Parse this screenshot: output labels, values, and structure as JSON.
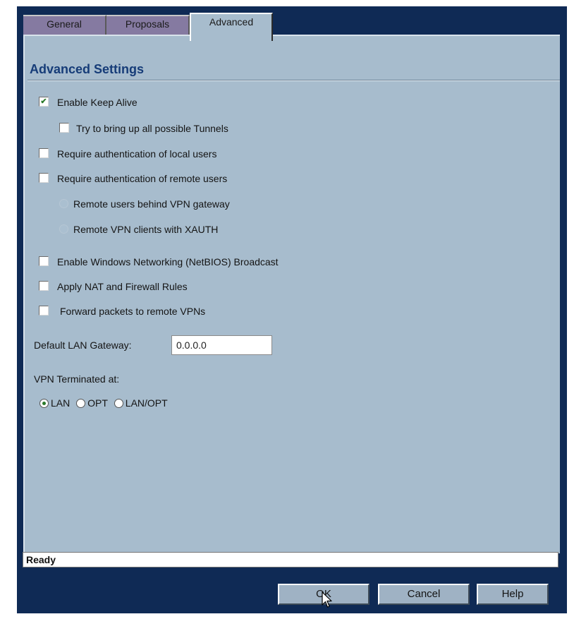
{
  "tabs": [
    {
      "label": "General"
    },
    {
      "label": "Proposals"
    },
    {
      "label": "Advanced"
    }
  ],
  "section_title": "Advanced Settings",
  "options": {
    "keep_alive": {
      "label": "Enable Keep Alive",
      "checked": true
    },
    "bring_up_tunnels": {
      "label": "Try to bring up all possible Tunnels",
      "checked": false
    },
    "auth_local": {
      "label": "Require authentication of local users",
      "checked": false
    },
    "auth_remote": {
      "label": "Require authentication of remote users",
      "checked": false
    },
    "remote_behind_gw": {
      "label": "Remote users behind VPN gateway",
      "enabled": false
    },
    "remote_xauth": {
      "label": "Remote VPN clients with XAUTH",
      "enabled": false
    },
    "netbios": {
      "label": "Enable Windows Networking (NetBIOS) Broadcast",
      "checked": false
    },
    "nat_rules": {
      "label": "Apply NAT and Firewall Rules",
      "checked": false
    },
    "forward_packets": {
      "label": "Forward packets to remote VPNs",
      "checked": false
    }
  },
  "gateway": {
    "label": "Default LAN Gateway:",
    "value": "0.0.0.0"
  },
  "vpn_terminated": {
    "label": "VPN Terminated at:",
    "choices": [
      {
        "label": "LAN",
        "selected": true
      },
      {
        "label": "OPT",
        "selected": false
      },
      {
        "label": "LAN/OPT",
        "selected": false
      }
    ]
  },
  "status": "Ready",
  "buttons": {
    "ok": "OK",
    "cancel": "Cancel",
    "help": "Help"
  },
  "colors": {
    "panel": "#a7bccd",
    "frame": "#0f2a55",
    "heading": "#163c78",
    "inactive_tab": "#857aa1"
  }
}
